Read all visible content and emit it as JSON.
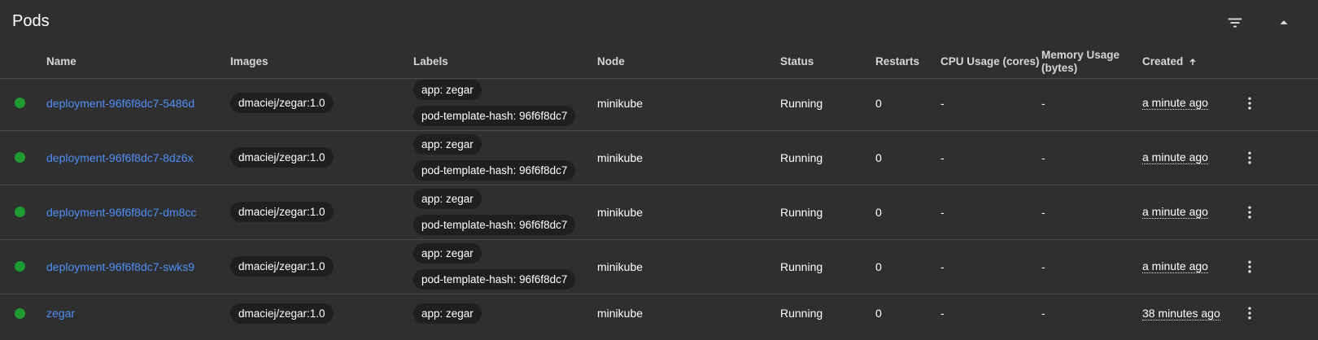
{
  "header": {
    "title": "Pods"
  },
  "columns": {
    "name": "Name",
    "images": "Images",
    "labels": "Labels",
    "node": "Node",
    "status": "Status",
    "restarts": "Restarts",
    "cpu": "CPU Usage (cores)",
    "memory_line1": "Memory Usage",
    "memory_line2": "(bytes)",
    "created": "Created"
  },
  "colors": {
    "status_running": "#1e9a33",
    "link": "#4f8ff7",
    "background": "#2f2f2f",
    "chip": "#1f1f1f"
  },
  "icons": {
    "filter": "filter-icon",
    "collapse": "collapse-up-icon",
    "sort": "arrow-up-icon",
    "menu": "more-vert-icon",
    "status": "status-dot-icon"
  },
  "pods": [
    {
      "name": "deployment-96f6f8dc7-5486d",
      "image": "dmaciej/zegar:1.0",
      "labels": [
        "app: zegar",
        "pod-template-hash: 96f6f8dc7"
      ],
      "node": "minikube",
      "status": "Running",
      "restarts": "0",
      "cpu": "-",
      "memory": "-",
      "created": "a minute ago"
    },
    {
      "name": "deployment-96f6f8dc7-8dz6x",
      "image": "dmaciej/zegar:1.0",
      "labels": [
        "app: zegar",
        "pod-template-hash: 96f6f8dc7"
      ],
      "node": "minikube",
      "status": "Running",
      "restarts": "0",
      "cpu": "-",
      "memory": "-",
      "created": "a minute ago"
    },
    {
      "name": "deployment-96f6f8dc7-dm8cc",
      "image": "dmaciej/zegar:1.0",
      "labels": [
        "app: zegar",
        "pod-template-hash: 96f6f8dc7"
      ],
      "node": "minikube",
      "status": "Running",
      "restarts": "0",
      "cpu": "-",
      "memory": "-",
      "created": "a minute ago"
    },
    {
      "name": "deployment-96f6f8dc7-swks9",
      "image": "dmaciej/zegar:1.0",
      "labels": [
        "app: zegar",
        "pod-template-hash: 96f6f8dc7"
      ],
      "node": "minikube",
      "status": "Running",
      "restarts": "0",
      "cpu": "-",
      "memory": "-",
      "created": "a minute ago"
    },
    {
      "name": "zegar",
      "image": "dmaciej/zegar:1.0",
      "labels": [
        "app: zegar"
      ],
      "node": "minikube",
      "status": "Running",
      "restarts": "0",
      "cpu": "-",
      "memory": "-",
      "created": "38 minutes ago"
    }
  ]
}
